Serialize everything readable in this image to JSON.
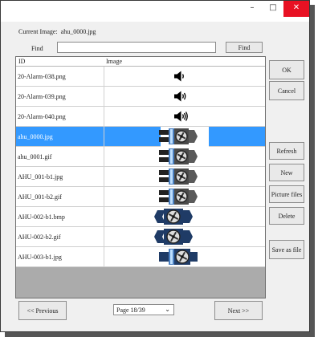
{
  "window": {
    "minimize": "–",
    "maximize": "□",
    "close": "✕"
  },
  "current_image": {
    "label": "Current Image:",
    "value": "ahu_0000.jpg"
  },
  "find": {
    "label": "Find",
    "value": "",
    "button": "Find"
  },
  "table": {
    "columns": [
      "ID",
      "Image"
    ],
    "rows": [
      {
        "id": "20-Alarm-038.png",
        "image": "speaker-low-icon"
      },
      {
        "id": "20-Alarm-039.png",
        "image": "speaker-medium-icon"
      },
      {
        "id": "20-Alarm-040.png",
        "image": "speaker-high-icon"
      },
      {
        "id": "ahu_0000.jpg",
        "image": "ahu-fan-icon",
        "selected": true
      },
      {
        "id": "ahu_0001.gif",
        "image": "ahu-fan-icon"
      },
      {
        "id": "AHU_001-b1.jpg",
        "image": "ahu-fan-icon"
      },
      {
        "id": "AHU_001-b2.gif",
        "image": "ahu-fan-icon"
      },
      {
        "id": "AHU-002-b1.bmp",
        "image": "ahu-fan-icon"
      },
      {
        "id": "AHU-002-b2.gif",
        "image": "ahu-fan-icon"
      },
      {
        "id": "AHU-003-b1.jpg",
        "image": "ahu-fan-icon"
      }
    ]
  },
  "side_buttons": {
    "ok": "OK",
    "cancel": "Cancel",
    "refresh": "Refresh",
    "new": "New",
    "picture_files": "Picture files",
    "delete": "Delete",
    "save_as_file": "Save as file"
  },
  "pager": {
    "previous": "<< Previous",
    "page": "Page 18/39",
    "next": "Next >>"
  },
  "colors": {
    "selection": "#3399ff",
    "close_button": "#e81123",
    "icon_navy": "#1f3b66",
    "icon_gray": "#5a5a5a"
  }
}
